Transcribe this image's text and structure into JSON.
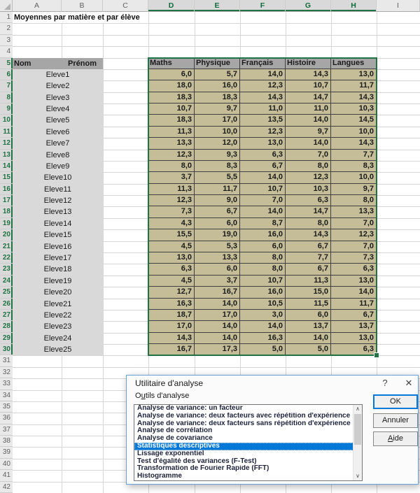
{
  "sheet": {
    "title_cell": "Moyennes par matière et par élève",
    "column_headers": [
      "A",
      "B",
      "C",
      "D",
      "E",
      "F",
      "G",
      "H",
      "I"
    ],
    "selected_columns": [
      "D",
      "E",
      "F",
      "G",
      "H"
    ],
    "row_count": 42,
    "selected_rows": {
      "from": 5,
      "to": 30
    },
    "name_table": {
      "headers": [
        "Nom",
        "Prénom"
      ],
      "students": [
        "Eleve1",
        "Eleve2",
        "Eleve3",
        "Eleve4",
        "Eleve5",
        "Eleve6",
        "Eleve7",
        "Eleve8",
        "Eleve9",
        "Eleve10",
        "Eleve11",
        "Eleve12",
        "Eleve13",
        "Eleve14",
        "Eleve15",
        "Eleve16",
        "Eleve17",
        "Eleve18",
        "Eleve19",
        "Eleve20",
        "Eleve21",
        "Eleve22",
        "Eleve23",
        "Eleve24",
        "Eleve25"
      ]
    },
    "grade_table": {
      "headers": [
        "Maths",
        "Physique",
        "Français",
        "Histoire",
        "Langues"
      ],
      "rows": [
        [
          "6,0",
          "5,7",
          "14,0",
          "14,3",
          "13,0"
        ],
        [
          "18,0",
          "16,0",
          "12,3",
          "10,7",
          "11,7"
        ],
        [
          "18,3",
          "18,3",
          "14,3",
          "14,7",
          "14,3"
        ],
        [
          "10,7",
          "9,7",
          "11,0",
          "11,0",
          "10,3"
        ],
        [
          "18,3",
          "17,0",
          "13,5",
          "14,0",
          "14,5"
        ],
        [
          "11,3",
          "10,0",
          "12,3",
          "9,7",
          "10,0"
        ],
        [
          "13,3",
          "12,0",
          "13,0",
          "14,0",
          "14,3"
        ],
        [
          "12,3",
          "9,3",
          "6,3",
          "7,0",
          "7,7"
        ],
        [
          "8,0",
          "8,3",
          "6,7",
          "8,0",
          "8,3"
        ],
        [
          "3,7",
          "5,5",
          "14,0",
          "12,3",
          "10,0"
        ],
        [
          "11,3",
          "11,7",
          "10,7",
          "10,3",
          "9,7"
        ],
        [
          "12,3",
          "9,0",
          "7,0",
          "6,3",
          "8,0"
        ],
        [
          "7,3",
          "6,7",
          "14,0",
          "14,7",
          "13,3"
        ],
        [
          "4,3",
          "6,0",
          "8,7",
          "8,0",
          "7,0"
        ],
        [
          "15,5",
          "19,0",
          "16,0",
          "14,3",
          "12,3"
        ],
        [
          "4,5",
          "5,3",
          "6,0",
          "6,7",
          "7,0"
        ],
        [
          "13,0",
          "13,3",
          "8,0",
          "7,7",
          "7,3"
        ],
        [
          "6,3",
          "6,0",
          "8,0",
          "6,7",
          "6,3"
        ],
        [
          "4,5",
          "3,7",
          "10,7",
          "11,3",
          "13,0"
        ],
        [
          "12,7",
          "16,7",
          "16,0",
          "15,0",
          "14,0"
        ],
        [
          "16,3",
          "14,0",
          "10,5",
          "11,5",
          "11,7"
        ],
        [
          "18,7",
          "17,0",
          "3,0",
          "6,0",
          "6,7"
        ],
        [
          "17,0",
          "14,0",
          "14,0",
          "13,7",
          "13,7"
        ],
        [
          "14,3",
          "14,0",
          "16,3",
          "14,0",
          "13,0"
        ],
        [
          "16,7",
          "17,3",
          "5,0",
          "5,0",
          "6,3"
        ]
      ]
    }
  },
  "dialog": {
    "title": "Utilitaire d'analyse",
    "help_glyph": "?",
    "close_glyph": "✕",
    "list_label": {
      "pre": "O",
      "accel": "u",
      "post": "tils d'analyse"
    },
    "tools": [
      "Analyse de variance: un facteur",
      "Analyse de variance: deux facteurs avec répétition d'expérience",
      "Analyse de variance: deux facteurs sans répétition d'expérience",
      "Analyse de corrélation",
      "Analyse de covariance",
      "Statistiques descriptives",
      "Lissage exponentiel",
      "Test d'égalité des variances (F-Test)",
      "Transformation de Fourier Rapide (FFT)",
      "Histogramme"
    ],
    "selected_tool": "Statistiques descriptives",
    "scrollbar": {
      "up_glyph": "∧",
      "down_glyph": "∨"
    },
    "buttons": {
      "ok": "OK",
      "cancel": "Annuler",
      "help": {
        "accel": "A",
        "post": "ide"
      }
    }
  },
  "colors": {
    "selection_green": "#217346",
    "grade_fill": "#C4BD97",
    "header_fill": "#A6A6A6",
    "name_fill": "#D9D9D9",
    "list_selection_blue": "#0078D7"
  }
}
